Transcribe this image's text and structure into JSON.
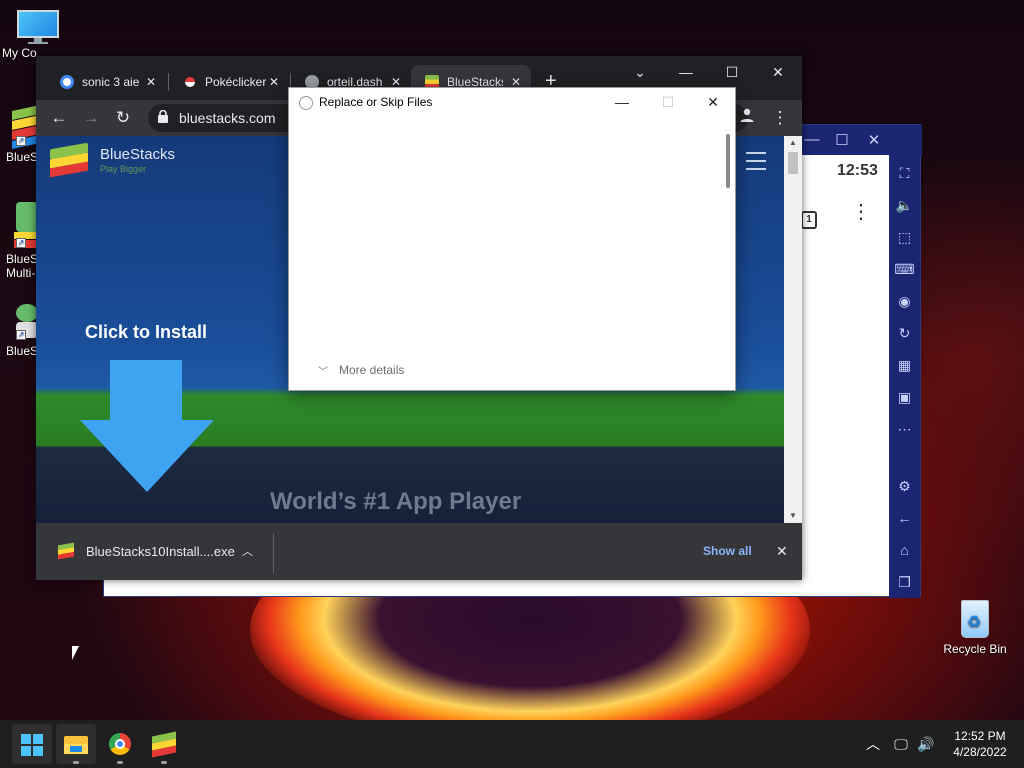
{
  "desktop": {
    "icons": [
      {
        "label": "My Co"
      },
      {
        "label": "BlueSt"
      },
      {
        "label": "BlueSt Multi-"
      },
      {
        "label": "BlueSt"
      }
    ],
    "recycle_bin": "Recycle Bin"
  },
  "chrome": {
    "tabs": [
      {
        "label": "sonic 3 aie"
      },
      {
        "label": "Pokéclicker"
      },
      {
        "label": "orteil.dash"
      },
      {
        "label": "BlueStacks"
      }
    ],
    "new_tab": "+",
    "url": "bluestacks.com",
    "page": {
      "logo_name": "BlueStacks",
      "logo_tagline": "Play Bigger",
      "install_text": "Click to Install",
      "headline": "World’s #1 App Player"
    },
    "download": {
      "filename": "BlueStacks10Install....exe",
      "show_all": "Show all"
    }
  },
  "dialog": {
    "title": "Replace or Skip Files",
    "more_details": "More details"
  },
  "bluestacks_player": {
    "time": "12:53",
    "notification_count": "1"
  },
  "taskbar": {
    "time": "12:52 PM",
    "date": "4/28/2022"
  },
  "colors": {
    "chrome_dark": "#202124",
    "chrome_toolbar": "#35363a",
    "bluestacks_frame": "#1a2672",
    "install_arrow": "#3ea3f0",
    "link_blue": "#8ab4f8"
  }
}
